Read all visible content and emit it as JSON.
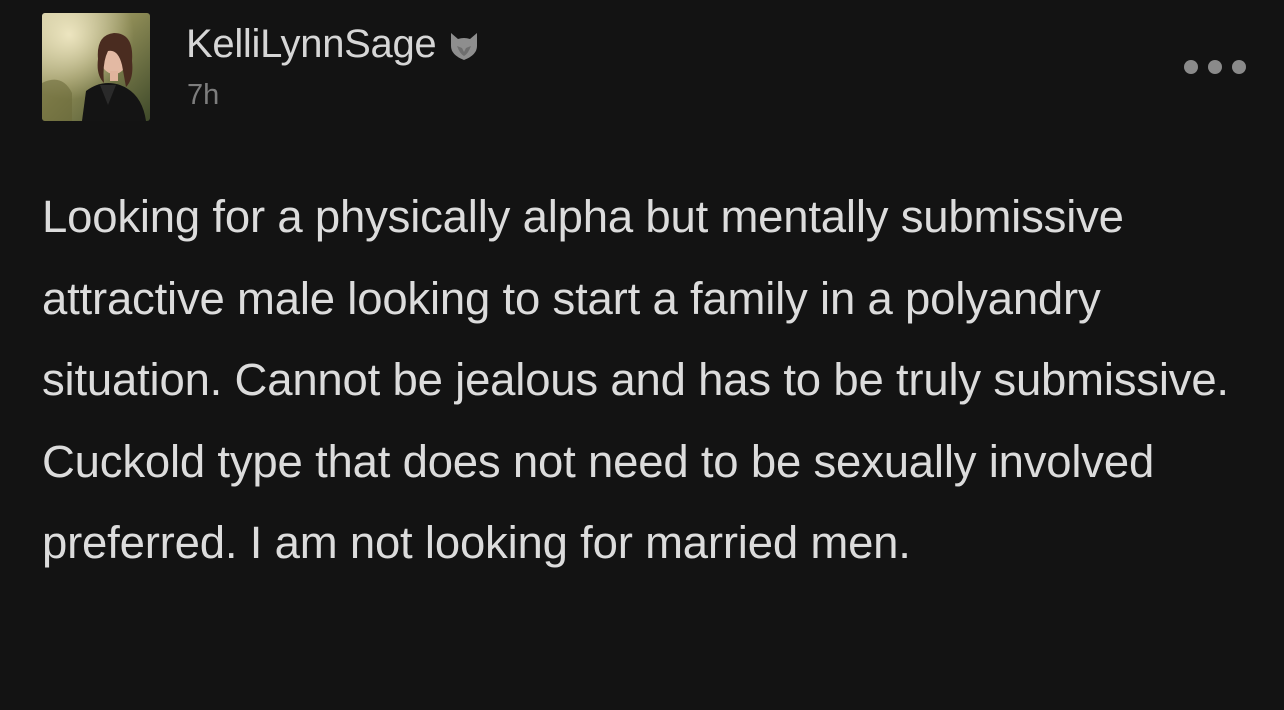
{
  "post": {
    "author": {
      "username": "KelliLynnSage",
      "badge_icon": "fox-shield-icon",
      "avatar_icon": "profile-photo"
    },
    "timestamp": "7h",
    "more_icon": "ellipsis-icon",
    "body": "Looking for a physically alpha but mentally submissive attractive male looking to start a family in a polyandry situation. Cannot be jealous and has to be truly submissive. Cuckold type that does not need to be sexually involved preferred. I am not looking for married men."
  },
  "colors": {
    "background": "#131313",
    "text": "#dcdcdc",
    "muted": "#7d7d7d",
    "icon": "#8a8a8a"
  }
}
